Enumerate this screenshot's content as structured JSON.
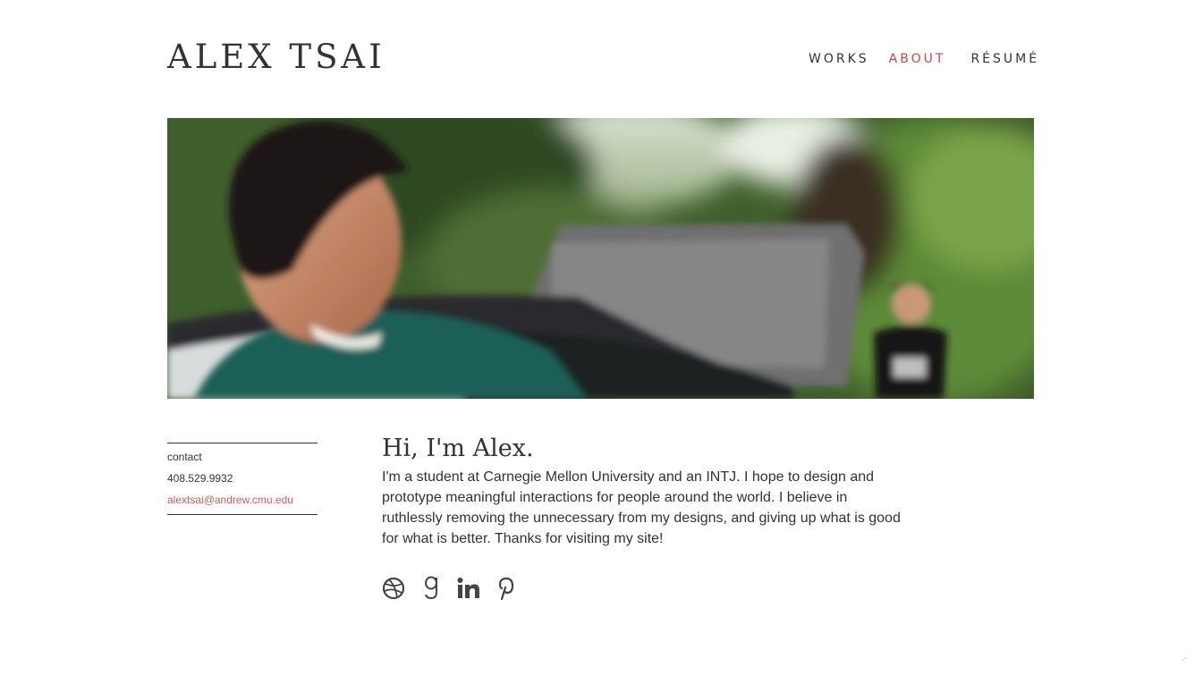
{
  "site": {
    "title": "ALEX TSAI"
  },
  "nav": {
    "items": [
      {
        "label": "WORKS"
      },
      {
        "label": "ABOUT"
      },
      {
        "label": "RÉSUMÉ"
      }
    ],
    "active_color": "#c5484a"
  },
  "sidebar": {
    "heading": "contact",
    "phone": "408.529.9932",
    "email": "alextsai@andrew.cmu.edu"
  },
  "intro": {
    "heading": "Hi, I'm Alex.",
    "body": "I'm a student at Carnegie Mellon University and an INTJ. I hope to design and prototype meaningful interactions for people around the world. I believe in ruthlessly removing the unnecessary from my designs, and giving up what is good for what is better. Thanks for visiting my site!"
  },
  "social": {
    "icons": [
      "dribbble-icon",
      "goodreads-icon",
      "linkedin-icon",
      "pinterest-icon"
    ],
    "icon_color": "#444444"
  }
}
